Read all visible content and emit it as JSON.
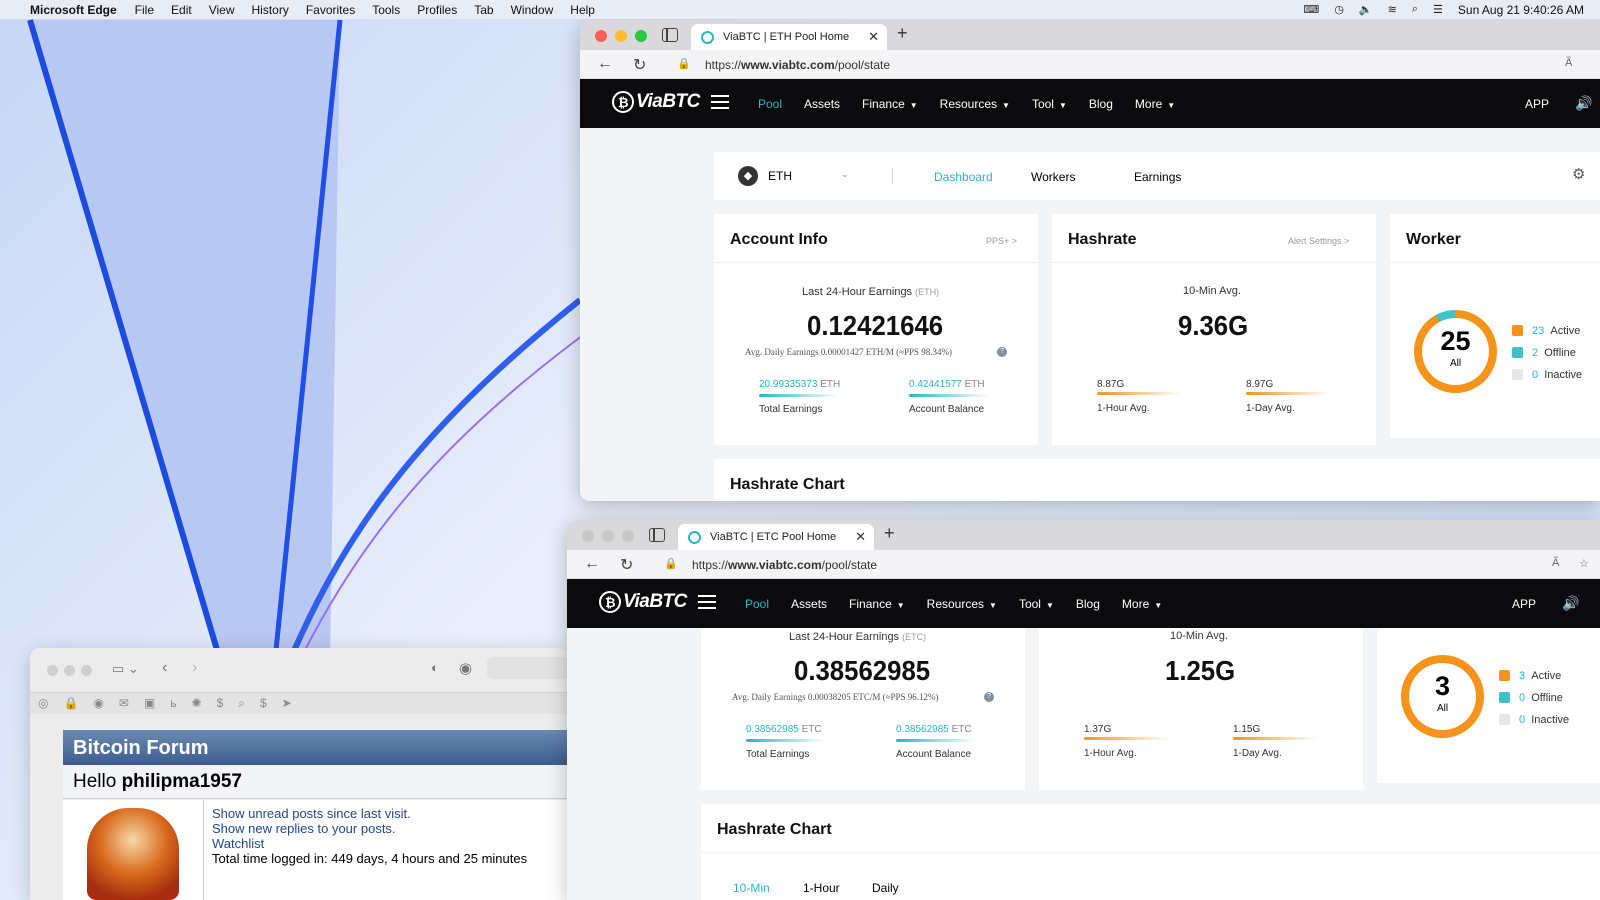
{
  "menubar": {
    "app_name": "Microsoft Edge",
    "items": [
      "File",
      "Edit",
      "View",
      "History",
      "Favorites",
      "Tools",
      "Profiles",
      "Tab",
      "Window",
      "Help"
    ],
    "datetime": "Sun Aug 21  9:40:26 AM"
  },
  "eth_window": {
    "tab_title": "ViaBTC | ETH Pool Home",
    "url_prefix": "https://",
    "url_host": "www.viabtc.com",
    "url_path": "/pool/state",
    "nav": {
      "logo": "ViaBTC",
      "links": [
        "Pool",
        "Assets",
        "Finance",
        "Resources",
        "Tool",
        "Blog",
        "More"
      ],
      "app": "APP"
    },
    "subnav": {
      "coin": "ETH",
      "tabs": [
        "Dashboard",
        "Workers",
        "Earnings"
      ]
    },
    "account": {
      "title": "Account Info",
      "link": "PPS+ >",
      "label": "Last 24-Hour Earnings",
      "unit": "(ETH)",
      "value": "0.12421646",
      "avg_note": "Avg. Daily Earnings 0.00001427 ETH/M (≈PPS 98.34%)",
      "total_value": "20.99335373",
      "total_unit": "ETH",
      "total_label": "Total Earnings",
      "balance_value": "0.42441577",
      "balance_unit": "ETH",
      "balance_label": "Account Balance"
    },
    "hashrate": {
      "title": "Hashrate",
      "link": "Alert Settings >",
      "label": "10-Min Avg.",
      "value": "9.36G",
      "hour_value": "8.87G",
      "hour_label": "1-Hour Avg.",
      "day_value": "8.97G",
      "day_label": "1-Day Avg."
    },
    "worker": {
      "title": "Worker",
      "total": "25",
      "all_label": "All",
      "active_count": "23",
      "active_label": "Active",
      "offline_count": "2",
      "offline_label": "Offline",
      "inactive_count": "0",
      "inactive_label": "Inactive",
      "active_fraction": 0.92,
      "offline_fraction": 0.08
    },
    "chart_title": "Hashrate Chart"
  },
  "etc_window": {
    "tab_title": "ViaBTC | ETC Pool Home",
    "url_prefix": "https://",
    "url_host": "www.viabtc.com",
    "url_path": "/pool/state",
    "nav": {
      "logo": "ViaBTC",
      "links": [
        "Pool",
        "Assets",
        "Finance",
        "Resources",
        "Tool",
        "Blog",
        "More"
      ],
      "app": "APP"
    },
    "account": {
      "label": "Last 24-Hour Earnings",
      "unit": "(ETC)",
      "value": "0.38562985",
      "avg_note": "Avg. Daily Earnings 0.00038205 ETC/M (≈PPS 96.12%)",
      "total_value": "0.38562985",
      "total_unit": "ETC",
      "total_label": "Total Earnings",
      "balance_value": "0.38562985",
      "balance_unit": "ETC",
      "balance_label": "Account Balance"
    },
    "hashrate": {
      "label": "10-Min Avg.",
      "value": "1.25G",
      "hour_value": "1.37G",
      "hour_label": "1-Hour Avg.",
      "day_value": "1.15G",
      "day_label": "1-Day Avg."
    },
    "worker": {
      "total": "3",
      "all_label": "All",
      "active_count": "3",
      "active_label": "Active",
      "offline_count": "0",
      "offline_label": "Offline",
      "inactive_count": "0",
      "inactive_label": "Inactive",
      "active_fraction": 1.0
    },
    "chart_title": "Hashrate Chart",
    "chart_tabs": [
      "10-Min",
      "1-Hour",
      "Daily"
    ]
  },
  "forum": {
    "title": "Bitcoin Forum",
    "hello_prefix": "Hello ",
    "username": "philipma1957",
    "links": [
      "Show unread posts since last visit.",
      "Show new replies to your posts.",
      "Watchlist"
    ],
    "time_logged": "Total time logged in: 449 days, 4 hours and 25 minutes"
  },
  "colors": {
    "accent": "#22b8c8",
    "active": "#f7931a",
    "offline": "#3ec1c9",
    "inactive": "#e6e6e6"
  }
}
